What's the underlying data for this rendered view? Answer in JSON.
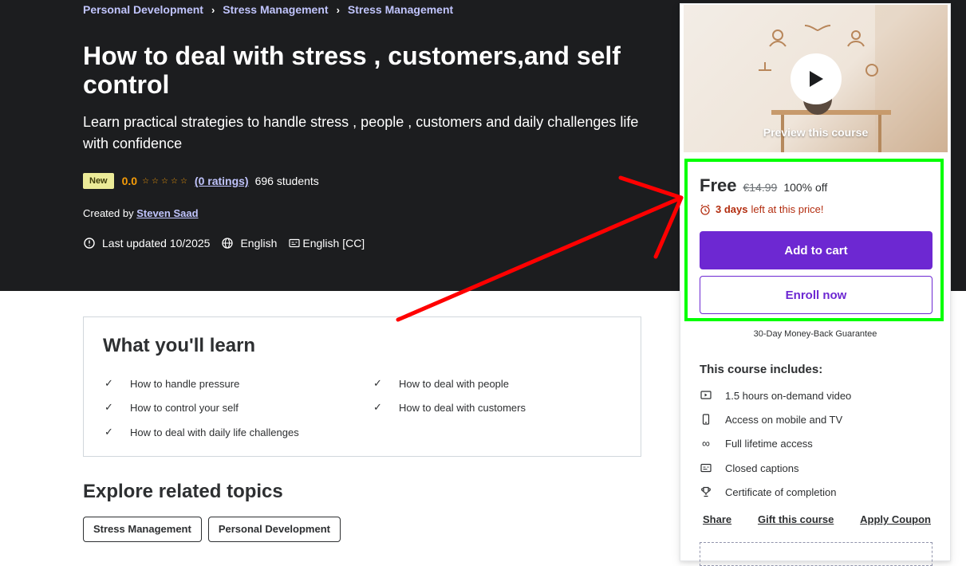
{
  "breadcrumb": [
    "Personal Development",
    "Stress Management",
    "Stress Management"
  ],
  "course": {
    "title": "How to deal with stress , customers,and self control",
    "subtitle": "Learn practical strategies to handle stress , people , customers and daily challenges life with confidence",
    "badge": "New",
    "rating": "0.0",
    "stars": "☆☆☆☆☆",
    "ratings_link": "(0 ratings)",
    "students": "696 students",
    "created_prefix": "Created by",
    "author": "Steven Saad",
    "last_updated": "Last updated 10/2025",
    "language": "English",
    "captions": "English [CC]"
  },
  "learn": {
    "title": "What you'll learn",
    "items": [
      "How to handle pressure",
      "How to deal with people",
      "How to control your self",
      "How to deal with customers",
      "How to deal with daily life challenges"
    ]
  },
  "explore": {
    "title": "Explore related topics",
    "topics": [
      "Stress Management",
      "Personal Development"
    ]
  },
  "sidebar": {
    "preview_label": "Preview this course",
    "price": "Free",
    "original_price": "€14.99",
    "discount": "100% off",
    "timer_bold": "3 days",
    "timer_rest": "left at this price!",
    "add_to_cart": "Add to cart",
    "enroll_now": "Enroll now",
    "guarantee": "30-Day Money-Back Guarantee",
    "includes_title": "This course includes:",
    "includes": [
      {
        "icon": "video-icon",
        "label": "1.5 hours on-demand video"
      },
      {
        "icon": "mobile-icon",
        "label": "Access on mobile and TV"
      },
      {
        "icon": "infinity-icon",
        "label": "Full lifetime access"
      },
      {
        "icon": "captions-icon",
        "label": "Closed captions"
      },
      {
        "icon": "trophy-icon",
        "label": "Certificate of completion"
      }
    ],
    "links": [
      "Share",
      "Gift this course",
      "Apply Coupon"
    ]
  },
  "colors": {
    "hero_bg": "#1c1d1f",
    "accent_purple": "#6d28d2",
    "breadcrumb_link": "#c0c4fc",
    "rating_orange": "#f69c08",
    "timer_red": "#b32d0f",
    "highlight_green": "#00ff00",
    "annotation_arrow": "#ff0000"
  }
}
